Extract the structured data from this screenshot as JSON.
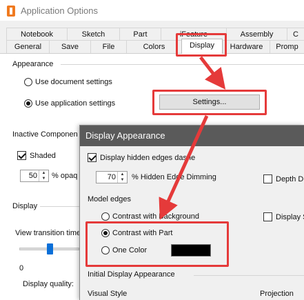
{
  "window": {
    "title": "Application Options"
  },
  "tabs_row1": [
    "Notebook",
    "Sketch",
    "Part",
    "iFeature",
    "Assembly",
    "C"
  ],
  "tabs_row2": [
    "General",
    "Save",
    "File",
    "Colors",
    "Display",
    "Hardware",
    "Promp"
  ],
  "active_tab": "Display",
  "appearance": {
    "heading": "Appearance",
    "opt_document": "Use document settings",
    "opt_application": "Use application settings",
    "settings_button": "Settings..."
  },
  "inactive": {
    "heading": "Inactive Componen",
    "shaded": "Shaded",
    "opacity_value": "50",
    "opacity_label": "% opaq"
  },
  "display": {
    "heading": "Display",
    "view_transition": "View transition time",
    "slider_min": "0",
    "slider_value_fraction": 0.5,
    "display_quality": "Display quality:"
  },
  "dialog": {
    "title": "Display Appearance",
    "hidden_edges": "Display hidden edges dashe",
    "dimming_value": "70",
    "dimming_label": "% Hidden Edge Dimming",
    "depth_dim": "Depth Dim",
    "model_edges": "Model edges",
    "contrast_background": "Contrast with Background",
    "display_si": "Display Si",
    "contrast_part": "Contrast with Part",
    "one_color": "One Color",
    "one_color_value": "#000000",
    "initial_heading": "Initial Display Appearance",
    "visual_style": "Visual Style",
    "projection": "Projection"
  },
  "colors": {
    "highlight": "#e53a3a",
    "accent": "#0a6fd8",
    "dialog_title_bg": "#5a5a5a"
  }
}
